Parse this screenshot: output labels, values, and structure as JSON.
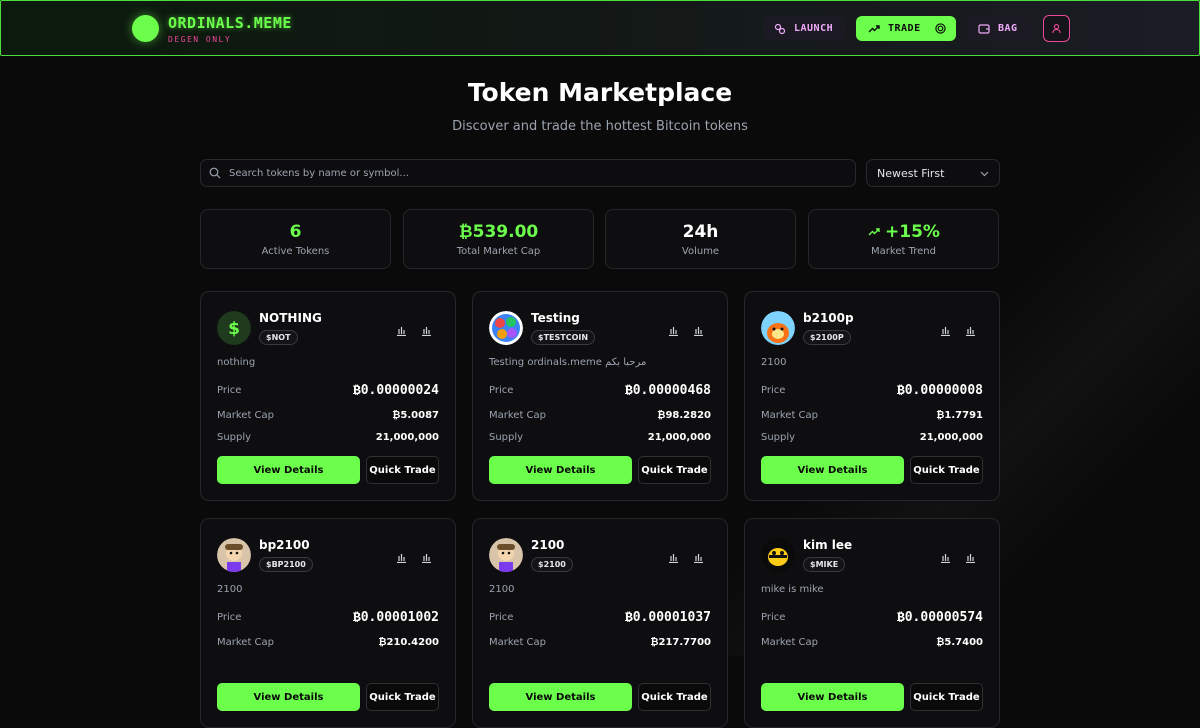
{
  "header": {
    "brand": "ORDINALS.MEME",
    "tagline": "DEGEN ONLY",
    "nav": {
      "launch": "LAUNCH",
      "trade": "TRADE",
      "bag": "BAG"
    },
    "accent": "#6bff4b",
    "pink": "#ec4899"
  },
  "page": {
    "title": "Token Marketplace",
    "subtitle": "Discover and trade the hottest Bitcoin tokens"
  },
  "search": {
    "placeholder": "Search tokens by name or symbol..."
  },
  "sort": {
    "selected": "Newest First"
  },
  "stats": [
    {
      "value": "6",
      "label": "Active Tokens"
    },
    {
      "value": "₿539.00",
      "label": "Total Market Cap"
    },
    {
      "value": "24h",
      "label": "Volume"
    },
    {
      "value": "+15%",
      "label": "Market Trend"
    }
  ],
  "card_labels": {
    "price": "Price",
    "market_cap": "Market Cap",
    "supply": "Supply",
    "view_details": "View Details",
    "quick_trade": "Quick Trade"
  },
  "tokens": [
    {
      "name": "NOTHING",
      "symbol": "$NOT",
      "description": "nothing",
      "price": "₿0.00000024",
      "market_cap": "₿5.0087",
      "supply": "21,000,000",
      "avatar": "dollar-icon"
    },
    {
      "name": "Testing",
      "symbol": "$TESTCOIN",
      "description": "Testing ordinals.meme مرحبا بكم",
      "price": "₿0.00000468",
      "market_cap": "₿98.2820",
      "supply": "21,000,000",
      "avatar": "colorful-image"
    },
    {
      "name": "b2100p",
      "symbol": "$2100P",
      "description": "2100",
      "price": "₿0.00000008",
      "market_cap": "₿1.7791",
      "supply": "21,000,000",
      "avatar": "dog-image"
    },
    {
      "name": "bp2100",
      "symbol": "$BP2100",
      "description": "2100",
      "price": "₿0.00001002",
      "market_cap": "₿210.4200",
      "supply": "",
      "avatar": "character-image"
    },
    {
      "name": "2100",
      "symbol": "$2100",
      "description": "2100",
      "price": "₿0.00001037",
      "market_cap": "₿217.7700",
      "supply": "",
      "avatar": "character-image"
    },
    {
      "name": "kim lee",
      "symbol": "$MIKE",
      "description": "mike is mike",
      "price": "₿0.00000574",
      "market_cap": "₿5.7400",
      "supply": "",
      "avatar": "bee-image"
    }
  ]
}
